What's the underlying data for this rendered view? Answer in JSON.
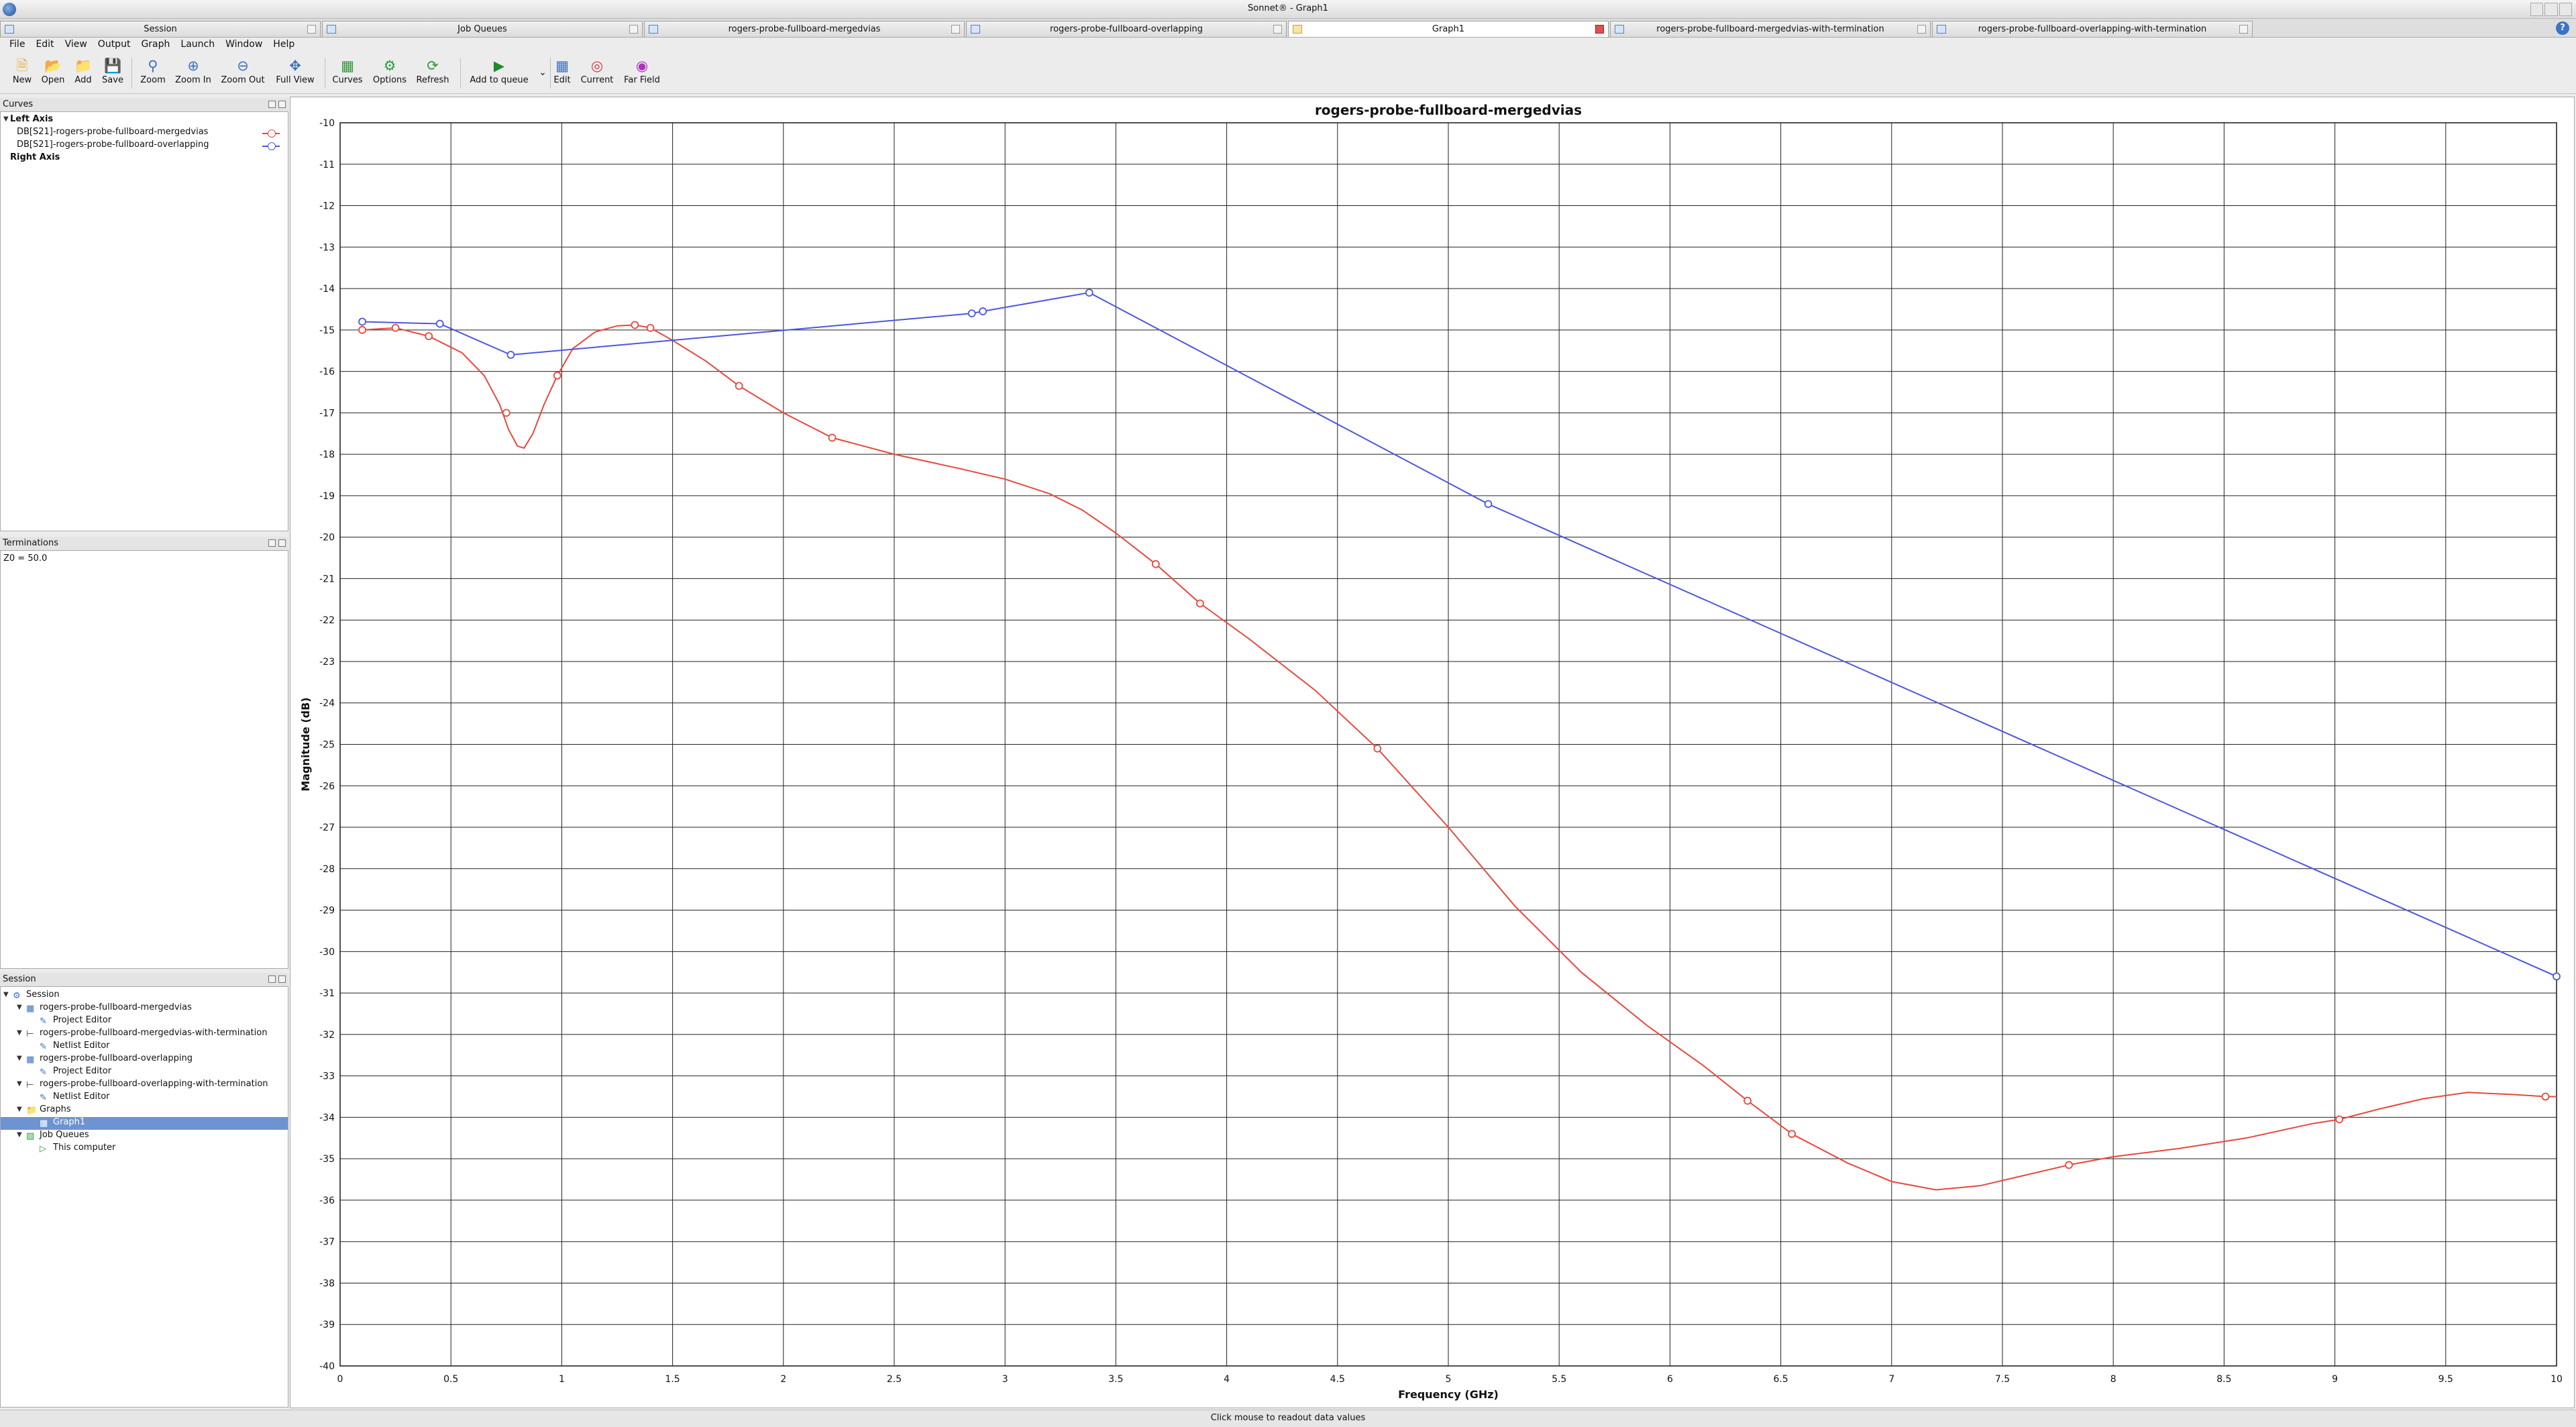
{
  "window": {
    "title": "Sonnet® - Graph1"
  },
  "tabs": [
    {
      "label": "Session",
      "active": false
    },
    {
      "label": "Job Queues",
      "active": false
    },
    {
      "label": "rogers-probe-fullboard-mergedvias",
      "active": false
    },
    {
      "label": "rogers-probe-fullboard-overlapping",
      "active": false
    },
    {
      "label": "Graph1",
      "active": true
    },
    {
      "label": "rogers-probe-fullboard-mergedvias-with-termination",
      "active": false
    },
    {
      "label": "rogers-probe-fullboard-overlapping-with-termination",
      "active": false
    }
  ],
  "menu": [
    "File",
    "Edit",
    "View",
    "Output",
    "Graph",
    "Launch",
    "Window",
    "Help"
  ],
  "toolbar": [
    {
      "label": "New",
      "icon": "new-file-icon"
    },
    {
      "label": "Open",
      "icon": "open-folder-icon"
    },
    {
      "label": "Add",
      "icon": "add-folder-icon"
    },
    {
      "label": "Save",
      "icon": "save-icon"
    },
    {
      "label": "Zoom",
      "icon": "zoom-icon"
    },
    {
      "label": "Zoom In",
      "icon": "zoom-in-icon"
    },
    {
      "label": "Zoom Out",
      "icon": "zoom-out-icon"
    },
    {
      "label": "Full View",
      "icon": "full-view-icon"
    },
    {
      "label": "Curves",
      "icon": "curves-icon"
    },
    {
      "label": "Options",
      "icon": "options-gear-icon"
    },
    {
      "label": "Refresh",
      "icon": "refresh-icon"
    },
    {
      "label": "Add to queue",
      "icon": "add-to-queue-icon"
    },
    {
      "label": "Edit",
      "icon": "edit-icon"
    },
    {
      "label": "Current",
      "icon": "current-icon"
    },
    {
      "label": "Far Field",
      "icon": "far-field-icon"
    }
  ],
  "curves_panel": {
    "title": "Curves",
    "left_axis_label": "Left Axis",
    "right_axis_label": "Right Axis",
    "curves": [
      {
        "label": "DB[S21]-rogers-probe-fullboard-mergedvias",
        "color": "#e8483c"
      },
      {
        "label": "DB[S21]-rogers-probe-fullboard-overlapping",
        "color": "#4b57e0"
      }
    ]
  },
  "terminations_panel": {
    "title": "Terminations",
    "text": "Z0 = 50.0"
  },
  "session_panel": {
    "title": "Session",
    "items": [
      {
        "label": "Session",
        "level": 0,
        "expandable": true,
        "icon": "session-icon"
      },
      {
        "label": "rogers-probe-fullboard-mergedvias",
        "level": 1,
        "expandable": true,
        "icon": "project-icon"
      },
      {
        "label": "Project Editor",
        "level": 2,
        "expandable": false,
        "icon": "editor-icon"
      },
      {
        "label": "rogers-probe-fullboard-mergedvias-with-termination",
        "level": 1,
        "expandable": true,
        "icon": "netlist-icon"
      },
      {
        "label": "Netlist Editor",
        "level": 2,
        "expandable": false,
        "icon": "editor-icon"
      },
      {
        "label": "rogers-probe-fullboard-overlapping",
        "level": 1,
        "expandable": true,
        "icon": "project-icon"
      },
      {
        "label": "Project Editor",
        "level": 2,
        "expandable": false,
        "icon": "editor-icon"
      },
      {
        "label": "rogers-probe-fullboard-overlapping-with-termination",
        "level": 1,
        "expandable": true,
        "icon": "netlist-icon"
      },
      {
        "label": "Netlist Editor",
        "level": 2,
        "expandable": false,
        "icon": "editor-icon"
      },
      {
        "label": "Graphs",
        "level": 1,
        "expandable": true,
        "icon": "folder-icon"
      },
      {
        "label": "Graph1",
        "level": 2,
        "expandable": false,
        "icon": "graph-icon",
        "selected": true
      },
      {
        "label": "Job Queues",
        "level": 1,
        "expandable": true,
        "icon": "queue-icon"
      },
      {
        "label": "This computer",
        "level": 2,
        "expandable": false,
        "icon": "play-icon"
      }
    ]
  },
  "status": {
    "text": "Click mouse to readout data values"
  },
  "chart_data": {
    "type": "line",
    "title": "rogers-probe-fullboard-mergedvias",
    "xlabel": "Frequency (GHz)",
    "ylabel": "Magnitude (dB)",
    "xlim": [
      0,
      10
    ],
    "ylim": [
      -40,
      -10
    ],
    "xticks": [
      0,
      0.5,
      1,
      1.5,
      2,
      2.5,
      3,
      3.5,
      4,
      4.5,
      5,
      5.5,
      6,
      6.5,
      7,
      7.5,
      8,
      8.5,
      9,
      9.5,
      10
    ],
    "yticks": [
      -10,
      -11,
      -12,
      -13,
      -14,
      -15,
      -16,
      -17,
      -18,
      -19,
      -20,
      -21,
      -22,
      -23,
      -24,
      -25,
      -26,
      -27,
      -28,
      -29,
      -30,
      -31,
      -32,
      -33,
      -34,
      -35,
      -36,
      -37,
      -38,
      -39,
      -40
    ],
    "grid": true,
    "series": [
      {
        "name": "DB[S21]-rogers-probe-fullboard-mergedvias",
        "color": "#e8483c",
        "line": {
          "x": [
            0.1,
            0.25,
            0.4,
            0.55,
            0.65,
            0.72,
            0.76,
            0.8,
            0.83,
            0.87,
            0.92,
            0.98,
            1.05,
            1.15,
            1.25,
            1.33,
            1.4,
            1.5,
            1.65,
            1.8,
            2.0,
            2.22,
            2.5,
            2.8,
            3.0,
            3.2,
            3.35,
            3.5,
            3.68,
            3.88,
            4.1,
            4.4,
            4.68,
            5.0,
            5.3,
            5.6,
            5.9,
            6.15,
            6.35,
            6.55,
            6.8,
            7.0,
            7.2,
            7.4,
            7.6,
            7.8,
            8.0,
            8.3,
            8.6,
            8.9,
            9.02,
            9.2,
            9.4,
            9.6,
            9.8,
            9.95,
            10.0
          ],
          "y": [
            -15.0,
            -14.95,
            -15.15,
            -15.55,
            -16.1,
            -16.8,
            -17.4,
            -17.8,
            -17.85,
            -17.5,
            -16.8,
            -16.1,
            -15.45,
            -15.05,
            -14.9,
            -14.88,
            -14.95,
            -15.25,
            -15.75,
            -16.35,
            -17.0,
            -17.6,
            -18.0,
            -18.35,
            -18.6,
            -18.95,
            -19.35,
            -19.9,
            -20.65,
            -21.6,
            -22.45,
            -23.7,
            -25.1,
            -27.0,
            -28.9,
            -30.5,
            -31.8,
            -32.75,
            -33.6,
            -34.4,
            -35.1,
            -35.55,
            -35.75,
            -35.65,
            -35.4,
            -35.15,
            -34.95,
            -34.75,
            -34.5,
            -34.15,
            -34.05,
            -33.8,
            -33.55,
            -33.4,
            -33.45,
            -33.5,
            -33.5
          ]
        },
        "markers": {
          "x": [
            0.1,
            0.25,
            0.4,
            0.75,
            0.98,
            1.33,
            1.4,
            1.8,
            2.22,
            3.68,
            3.88,
            4.68,
            6.35,
            6.55,
            7.8,
            9.02,
            9.95
          ],
          "y": [
            -15.0,
            -14.95,
            -15.15,
            -17.0,
            -16.1,
            -14.88,
            -14.95,
            -16.35,
            -17.6,
            -20.65,
            -21.6,
            -25.1,
            -33.6,
            -34.4,
            -35.15,
            -34.05,
            -33.5
          ]
        }
      },
      {
        "name": "DB[S21]-rogers-probe-fullboard-overlapping",
        "color": "#4b57e0",
        "line": {
          "x": [
            0.1,
            0.45,
            0.77,
            2.85,
            2.9,
            3.38,
            5.18,
            10.0
          ],
          "y": [
            -14.8,
            -14.85,
            -15.6,
            -14.6,
            -14.55,
            -14.1,
            -19.2,
            -30.6
          ]
        },
        "markers": {
          "x": [
            0.1,
            0.45,
            0.77,
            2.85,
            2.9,
            3.38,
            5.18,
            10.0
          ],
          "y": [
            -14.8,
            -14.85,
            -15.6,
            -14.6,
            -14.55,
            -14.1,
            -19.2,
            -30.6
          ]
        }
      }
    ]
  }
}
